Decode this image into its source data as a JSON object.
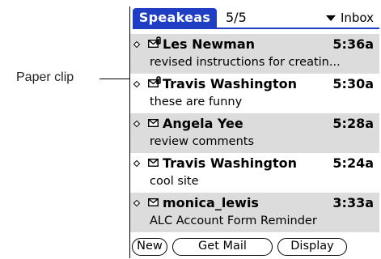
{
  "annotation": {
    "label": "Paper clip"
  },
  "title_bar": {
    "app_name": "Speakeas",
    "count": "5/5",
    "folder": "Inbox"
  },
  "messages": [
    {
      "sender": "Les Newman",
      "time": "5:36a",
      "subject": "revised instructions for creatin...",
      "has_attachment": true,
      "shaded": true
    },
    {
      "sender": "Travis Washington",
      "time": "5:30a",
      "subject": "these are funny",
      "has_attachment": true,
      "shaded": false
    },
    {
      "sender": "Angela Yee",
      "time": "5:28a",
      "subject": "review comments",
      "has_attachment": false,
      "shaded": true
    },
    {
      "sender": "Travis Washington",
      "time": "5:24a",
      "subject": "cool site",
      "has_attachment": false,
      "shaded": false
    },
    {
      "sender": "monica_lewis",
      "time": "3:33a",
      "subject": "ALC Account Form Reminder",
      "has_attachment": false,
      "shaded": true
    }
  ],
  "buttons": {
    "new": "New",
    "get_mail": "Get Mail",
    "display": "Display"
  },
  "colors": {
    "accent": "#1f3ec4",
    "row_shade": "#dcdcdc"
  },
  "icons": [
    "diamond-icon",
    "envelope-icon",
    "paper-clip-icon",
    "dropdown-triangle-icon"
  ]
}
